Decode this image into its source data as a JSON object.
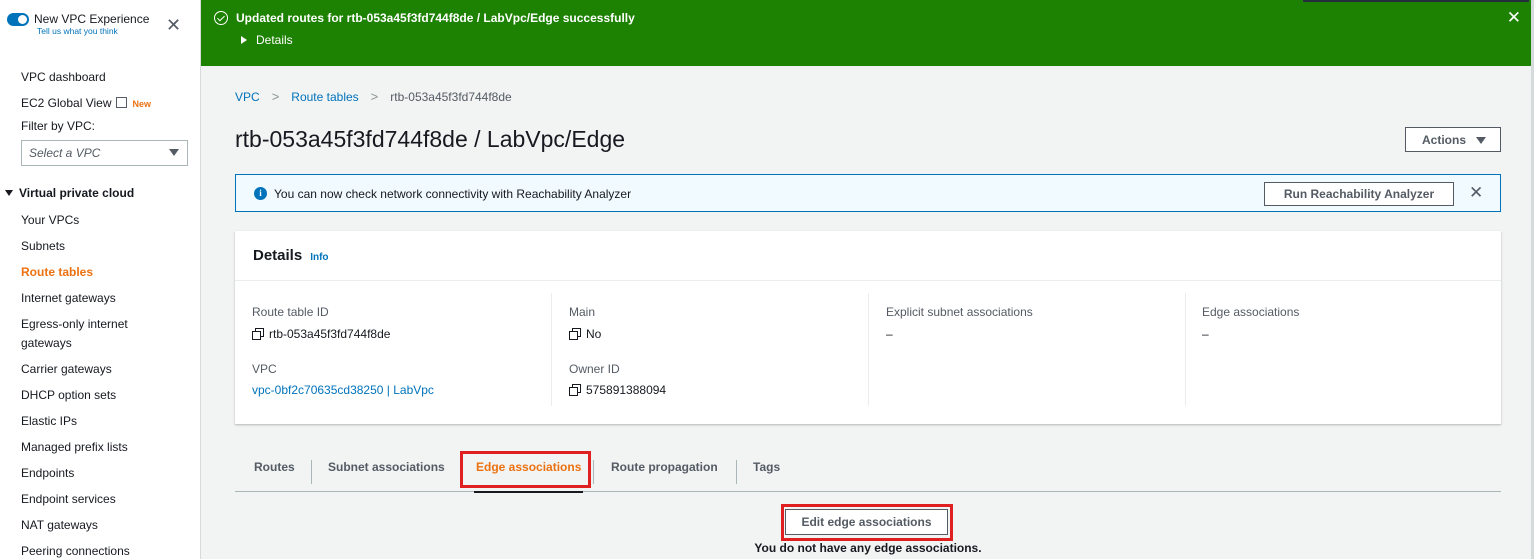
{
  "sidebar": {
    "toggle_title": "New VPC Experience",
    "toggle_sub": "Tell us what you think",
    "links_top": [
      {
        "label": "VPC dashboard"
      },
      {
        "label": "EC2 Global View",
        "badge": "New"
      }
    ],
    "filter_label": "Filter by VPC:",
    "filter_placeholder": "Select a VPC",
    "section_title": "Virtual private cloud",
    "items": [
      {
        "label": "Your VPCs"
      },
      {
        "label": "Subnets"
      },
      {
        "label": "Route tables"
      },
      {
        "label": "Internet gateways"
      },
      {
        "label": "Egress-only internet"
      },
      {
        "label": "gateways"
      },
      {
        "label": "Carrier gateways"
      },
      {
        "label": "DHCP option sets"
      },
      {
        "label": "Elastic IPs"
      },
      {
        "label": "Managed prefix lists"
      },
      {
        "label": "Endpoints"
      },
      {
        "label": "Endpoint services"
      },
      {
        "label": "NAT gateways"
      },
      {
        "label": "Peering connections"
      }
    ],
    "active_item": "Route tables"
  },
  "flash": {
    "message": "Updated routes for rtb-053a45f3fd744f8de / LabVpc/Edge successfully",
    "details_label": "Details",
    "color": "#1d8102"
  },
  "breadcrumb": {
    "items": [
      "VPC",
      "Route tables",
      "rtb-053a45f3fd744f8de"
    ]
  },
  "page": {
    "title": "rtb-053a45f3fd744f8de / LabVpc/Edge",
    "actions_label": "Actions"
  },
  "info_alert": {
    "text": "You can now check network connectivity with Reachability Analyzer",
    "button_label": "Run Reachability Analyzer"
  },
  "details": {
    "title": "Details",
    "info_link": "Info",
    "route_table_id_label": "Route table ID",
    "route_table_id": "rtb-053a45f3fd744f8de",
    "vpc_label": "VPC",
    "vpc_value": "vpc-0bf2c70635cd38250 | LabVpc",
    "main_label": "Main",
    "main_value": "No",
    "owner_label": "Owner ID",
    "owner_value": "575891388094",
    "explicit_label": "Explicit subnet associations",
    "explicit_value": "–",
    "edge_label": "Edge associations",
    "edge_value": "–"
  },
  "tabs": [
    {
      "label": "Routes"
    },
    {
      "label": "Subnet associations"
    },
    {
      "label": "Edge associations"
    },
    {
      "label": "Route propagation"
    },
    {
      "label": "Tags"
    }
  ],
  "active_tab": "Edge associations",
  "edge_panel": {
    "edit_button": "Edit edge associations",
    "empty_message": "You do not have any edge associations."
  },
  "colors": {
    "accent": "#ec7211",
    "link": "#0073bb",
    "highlight": "#e02020"
  },
  "icons": [
    "close-icon",
    "external-link-icon",
    "chevron-down-icon",
    "caret-down-icon",
    "check-circle-icon",
    "info-icon",
    "copy-icon",
    "chevron-right-icon"
  ]
}
